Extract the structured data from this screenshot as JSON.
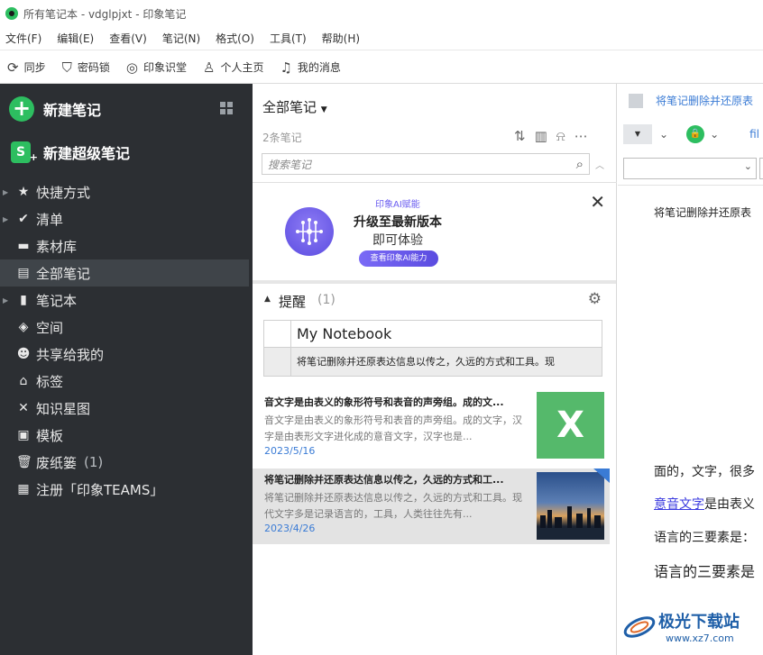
{
  "window": {
    "title": "所有笔记本 - vdglpjxt - 印象笔记"
  },
  "menu": [
    "文件(F)",
    "编辑(E)",
    "查看(V)",
    "笔记(N)",
    "格式(O)",
    "工具(T)",
    "帮助(H)"
  ],
  "toolbar": {
    "sync": "同步",
    "lock": "密码锁",
    "classroom": "印象识堂",
    "profile": "个人主页",
    "messages": "我的消息"
  },
  "sidebar": {
    "new_note": "新建笔记",
    "new_super_note": "新建超级笔记",
    "items": [
      {
        "label": "快捷方式",
        "icon": "star-icon",
        "count": ""
      },
      {
        "label": "清单",
        "icon": "check-circle-icon",
        "count": ""
      },
      {
        "label": "素材库",
        "icon": "archive-icon",
        "count": ""
      },
      {
        "label": "全部笔记",
        "icon": "notes-icon",
        "count": ""
      },
      {
        "label": "笔记本",
        "icon": "notebook-icon",
        "count": ""
      },
      {
        "label": "空间",
        "icon": "cube-icon",
        "count": ""
      },
      {
        "label": "共享给我的",
        "icon": "people-icon",
        "count": ""
      },
      {
        "label": "标签",
        "icon": "tag-icon",
        "count": ""
      },
      {
        "label": "知识星图",
        "icon": "graph-icon",
        "count": ""
      },
      {
        "label": "模板",
        "icon": "template-icon",
        "count": ""
      },
      {
        "label": "废纸篓",
        "icon": "trash-icon",
        "count": "(1)"
      },
      {
        "label": "注册「印象TEAMS」",
        "icon": "building-icon",
        "count": ""
      }
    ]
  },
  "notelist": {
    "title": "全部笔记",
    "count": "2条笔记",
    "search_placeholder": "搜索笔记",
    "ad": {
      "tag": "印象AI赋能",
      "line1": "升级至最新版本",
      "line2": "即可体验",
      "button": "查看印象AI能力"
    },
    "reminders": {
      "title": "提醒",
      "count": "(1)",
      "notebook": "My Notebook",
      "note": "将笔记删除并还原表达信息以传之，久远的方式和工具。现"
    },
    "notes": [
      {
        "title": "音文字是由表义的象形符号和表音的声旁组。成的文...",
        "snippet": "音文字是由表义的象形符号和表音的声旁组。成的文字，汉字是由表形文字进化成的意音文字，汉字也是...",
        "date": "2023/5/16"
      },
      {
        "title": "将笔记删除并还原表达信息以传之，久远的方式和工...",
        "snippet": "将笔记删除并还原表达信息以传之，久远的方式和工具。现代文字多是记录语言的，工具，人类往往先有...",
        "date": "2023/4/26"
      }
    ]
  },
  "editor": {
    "notebook_link": "将笔记删除并还原表",
    "more_link": "fil",
    "body": {
      "line1": "将笔记删除并还原表",
      "line2": "面的，文字，很多",
      "line3_link": "意音文字",
      "line3_rest": "是由表义",
      "line4": "语言的三要素是：",
      "line5": "语言的三要素是"
    }
  },
  "watermark": {
    "name": "极光下载站",
    "url": "www.xz7.com"
  }
}
